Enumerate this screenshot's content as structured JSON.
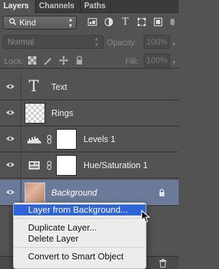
{
  "tabs": [
    {
      "label": "Layers",
      "active": true
    },
    {
      "label": "Channels",
      "active": false
    },
    {
      "label": "Paths",
      "active": false
    }
  ],
  "filter": {
    "kind_label": "Kind",
    "icons": [
      "pixel-filter-icon",
      "adjustment-filter-icon",
      "type-filter-icon",
      "shape-filter-icon",
      "smart-object-filter-icon"
    ]
  },
  "blend": {
    "mode": "Normal",
    "opacity_label": "Opacity:",
    "opacity_value": "100%"
  },
  "lock": {
    "label": "Lock:",
    "fill_label": "Fill:",
    "fill_value": "100%"
  },
  "layers": [
    {
      "name": "Text",
      "kind": "type",
      "visible": true
    },
    {
      "name": "Rings",
      "kind": "pixel",
      "visible": true
    },
    {
      "name": "Levels 1",
      "kind": "adjustment-levels",
      "visible": true
    },
    {
      "name": "Hue/Saturation 1",
      "kind": "adjustment-hue-saturation",
      "visible": true
    },
    {
      "name": "Background",
      "kind": "background",
      "visible": true,
      "selected": true,
      "locked": true
    }
  ],
  "context_menu": {
    "items": [
      {
        "label": "Layer from Background...",
        "highlighted": true
      },
      {
        "label": "Duplicate Layer..."
      },
      {
        "label": "Delete Layer"
      },
      {
        "label": "Convert to Smart Object"
      }
    ]
  },
  "colors": {
    "panel_bg": "#535353",
    "selected_layer_bg": "#6a7a98",
    "menu_highlight": "#2f63d9"
  }
}
